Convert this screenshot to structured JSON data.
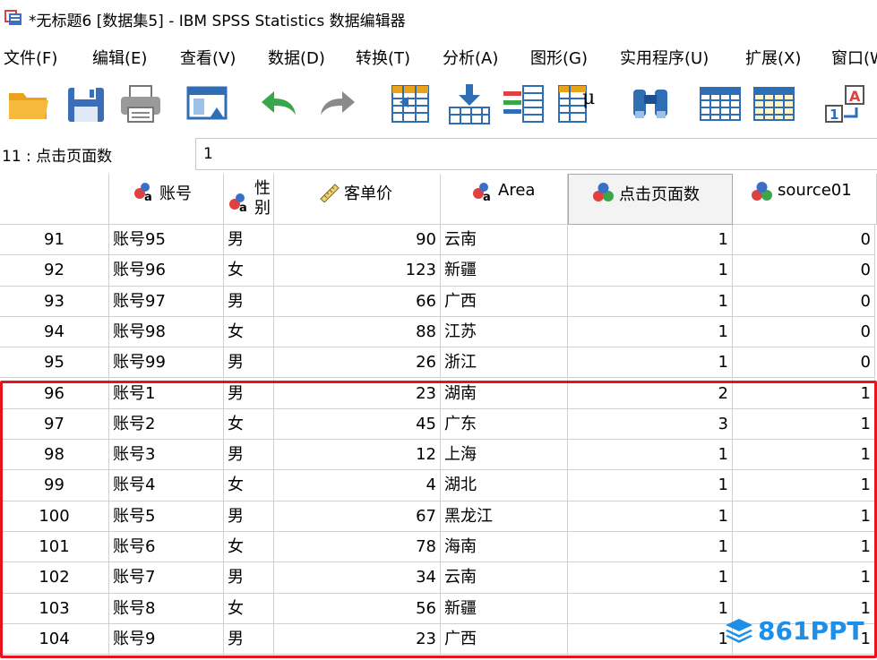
{
  "window": {
    "title": "*无标题6 [数据集5] - IBM SPSS Statistics 数据编辑器"
  },
  "menu": [
    {
      "label": "文件(F)"
    },
    {
      "label": "编辑(E)"
    },
    {
      "label": "查看(V)"
    },
    {
      "label": "数据(D)"
    },
    {
      "label": "转换(T)"
    },
    {
      "label": "分析(A)"
    },
    {
      "label": "图形(G)"
    },
    {
      "label": "实用程序(U)"
    },
    {
      "label": "扩展(X)"
    },
    {
      "label": "窗口(W"
    }
  ],
  "toolbar": {
    "icons": [
      "open-folder-icon",
      "save-icon",
      "print-icon",
      "dialog-recall-icon",
      "undo-icon",
      "redo-icon",
      "goto-case-icon",
      "goto-variable-icon",
      "variables-icon",
      "descriptives-icon",
      "find-icon",
      "split-file-icon",
      "weight-cases-icon",
      "value-labels-icon"
    ]
  },
  "cell_editor": {
    "reference": "11 : 点击页面数",
    "value": "1"
  },
  "columns": [
    {
      "name": "账号",
      "type": "nominal"
    },
    {
      "name": "性别",
      "name_line1": "性",
      "name_line2": "别",
      "type": "nominal"
    },
    {
      "name": "客单价",
      "type": "scale"
    },
    {
      "name": "Area",
      "type": "nominal"
    },
    {
      "name": "点击页面数",
      "type": "nominal",
      "selected": true
    },
    {
      "name": "source01",
      "type": "nominal"
    }
  ],
  "rows": [
    {
      "n": "91",
      "cells": [
        "账号95",
        "男",
        "90",
        "云南",
        "1",
        "0"
      ]
    },
    {
      "n": "92",
      "cells": [
        "账号96",
        "女",
        "123",
        "新疆",
        "1",
        "0"
      ]
    },
    {
      "n": "93",
      "cells": [
        "账号97",
        "男",
        "66",
        "广西",
        "1",
        "0"
      ]
    },
    {
      "n": "94",
      "cells": [
        "账号98",
        "女",
        "88",
        "江苏",
        "1",
        "0"
      ]
    },
    {
      "n": "95",
      "cells": [
        "账号99",
        "男",
        "26",
        "浙江",
        "1",
        "0"
      ]
    },
    {
      "n": "96",
      "cells": [
        "账号1",
        "男",
        "23",
        "湖南",
        "2",
        "1"
      ]
    },
    {
      "n": "97",
      "cells": [
        "账号2",
        "女",
        "45",
        "广东",
        "3",
        "1"
      ]
    },
    {
      "n": "98",
      "cells": [
        "账号3",
        "男",
        "12",
        "上海",
        "1",
        "1"
      ]
    },
    {
      "n": "99",
      "cells": [
        "账号4",
        "女",
        "4",
        "湖北",
        "1",
        "1"
      ]
    },
    {
      "n": "100",
      "cells": [
        "账号5",
        "男",
        "67",
        "黑龙江",
        "1",
        "1"
      ]
    },
    {
      "n": "101",
      "cells": [
        "账号6",
        "女",
        "78",
        "海南",
        "1",
        "1"
      ]
    },
    {
      "n": "102",
      "cells": [
        "账号7",
        "男",
        "34",
        "云南",
        "1",
        "1"
      ]
    },
    {
      "n": "103",
      "cells": [
        "账号8",
        "女",
        "56",
        "新疆",
        "1",
        "1"
      ]
    },
    {
      "n": "104",
      "cells": [
        "账号9",
        "男",
        "23",
        "广西",
        "1",
        "1"
      ]
    }
  ],
  "watermark": {
    "text": "861PPT",
    "color": "#1e8fe8"
  },
  "colors": {
    "highlight": "#e8141b"
  }
}
